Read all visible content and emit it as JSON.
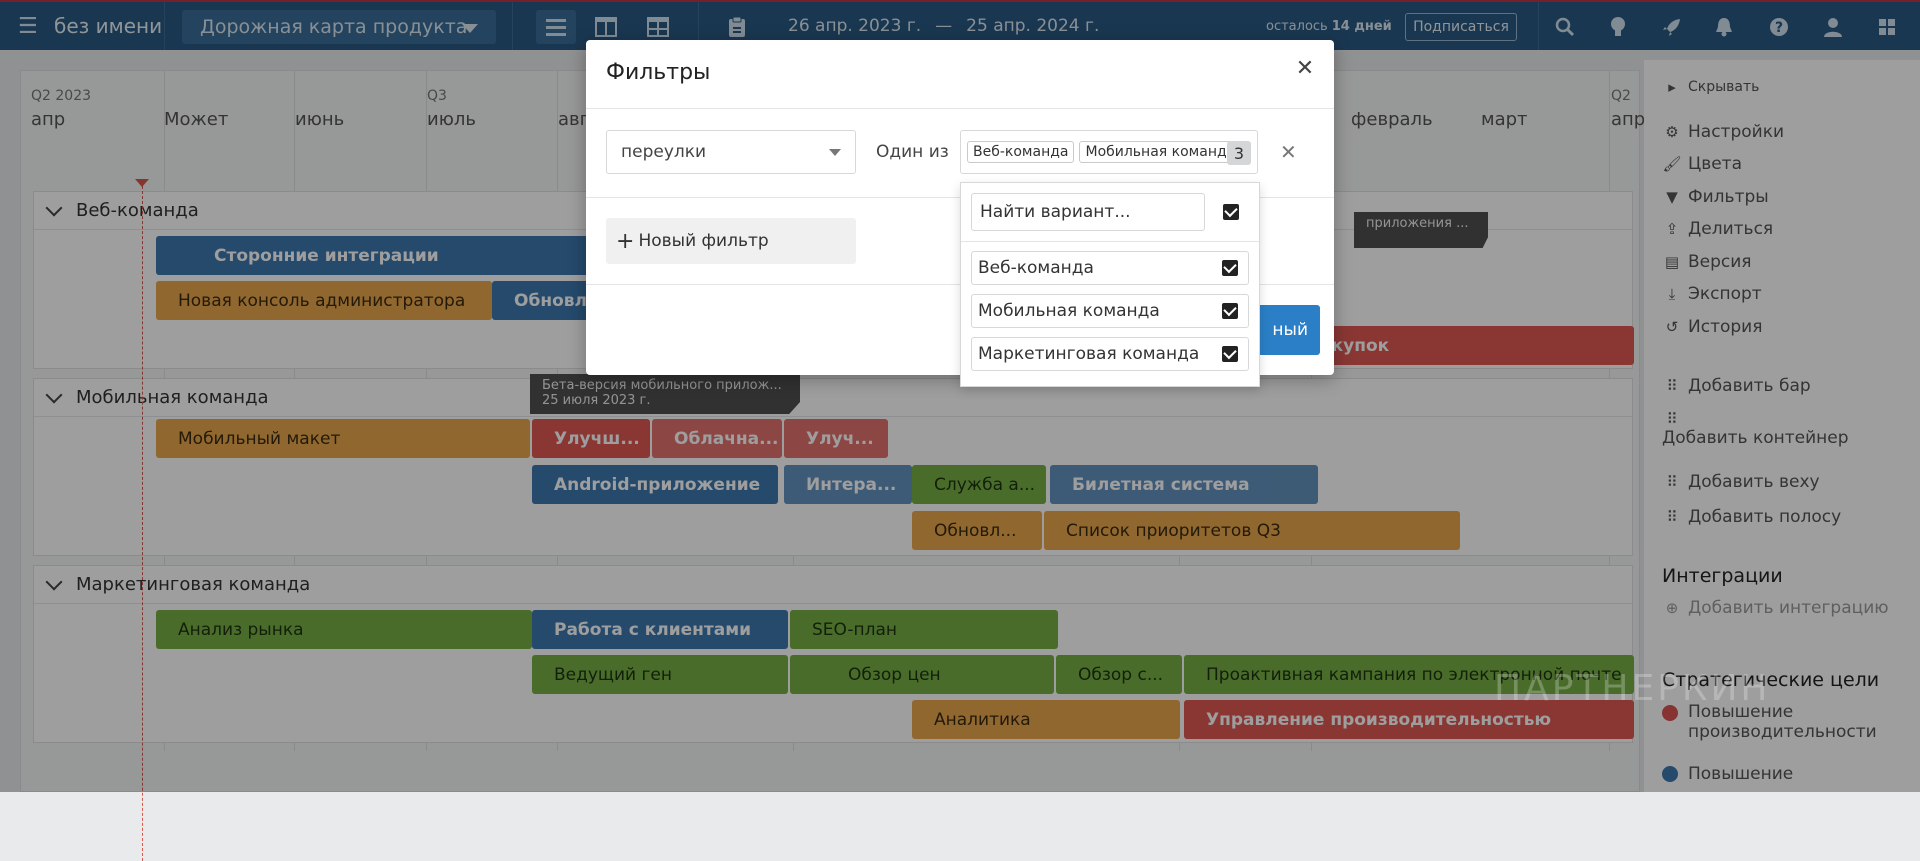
{
  "app": {
    "doc_title": "без имени",
    "roadmap": "Дорожная карта продукта",
    "date_start": "26 апр. 2023 г.",
    "date_sep": "—",
    "date_end": "25 апр. 2024 г.",
    "trial_prefix": "осталось",
    "trial_days": "14 дней",
    "subscribe": "Подписаться"
  },
  "timeline": {
    "quarters": [
      "Q2 2023",
      "Q3",
      "Q2"
    ],
    "months": [
      "апр",
      "Может",
      "июнь",
      "июль",
      "авг",
      "февраль",
      "март",
      "апр"
    ]
  },
  "lanes": [
    {
      "title": "Веб-команда",
      "bars": [
        "Сторонние интеграции",
        "Новая консоль администратора",
        "Обновле",
        "корзины покупок"
      ],
      "milestone": "приложения ..."
    },
    {
      "title": "Мобильная команда",
      "milestone_title": "Бета-версия мобильного прилож...",
      "milestone_date": "25 июля 2023 г.",
      "bars": [
        "Мобильный макет",
        "Улучш...",
        "Облачна...",
        "Улуч...",
        "Android-приложение",
        "Интера...",
        "Служба а...",
        "Билетная система",
        "Обновл...",
        "Список приоритетов Q3"
      ]
    },
    {
      "title": "Маркетинговая команда",
      "bars": [
        "Анализ рынка",
        "Работа с клиентами",
        "SEO-план",
        "Ведущий ген",
        "Обзор цен",
        "Обзор с...",
        "Проактивная кампания по электронной почте",
        "Аналитика",
        "Управление производительностью"
      ]
    }
  ],
  "panel": {
    "hide": "Скрывать",
    "items": [
      "Настройки",
      "Цвета",
      "Фильтры",
      "Делиться",
      "Версия",
      "Экспорт",
      "История"
    ],
    "add_items": [
      "Добавить бар",
      "Добавить контейнер",
      "Добавить веху",
      "Добавить полосу"
    ],
    "integrations_title": "Интеграции",
    "add_integration": "Добавить интеграцию",
    "goals_title": "Стратегические цели",
    "goals": [
      {
        "label": "Повышение производительности",
        "color": "#d9534f"
      },
      {
        "label": "Повышение",
        "color": "#3d78ae"
      }
    ]
  },
  "watermark": "ПАРТНЕРКИН",
  "modal": {
    "title": "Фильтры",
    "field": "переулки",
    "operator": "Один из",
    "tags": [
      "Веб-команда",
      "Мобильная команда"
    ],
    "tag_count": "3",
    "new_filter": "Новый фильтр",
    "apply_label": "ный",
    "search_value": "Найти вариант...",
    "options": [
      "Веб-команда",
      "Мобильная команда",
      "Маркетинговая команда"
    ]
  }
}
